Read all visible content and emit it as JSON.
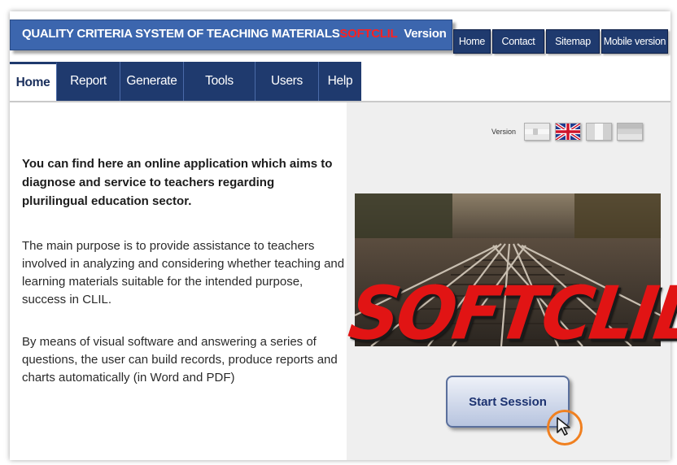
{
  "header": {
    "title_main": "QUALITY CRITERIA SYSTEM OF TEACHING MATERIALS",
    "title_brand": "SOFTCLIL",
    "title_suffix": "Version",
    "top_links": [
      "Home",
      "Contact",
      "Sitemap",
      "Mobile version"
    ]
  },
  "nav": {
    "items": [
      "Home",
      "Report",
      "Generate",
      "Tools",
      "Users",
      "Help"
    ],
    "active": "Home"
  },
  "content": {
    "intro": "You can find here an online application which aims to diagnose and service to teachers regarding plurilingual education sector.",
    "purpose": "The  main purpose is to provide assistance to teachers involved in analyzing and considering whether teaching and learning materials suitable for the intended purpose, success in CLIL.",
    "means": "By means of visual software and answering a series of questions, the user can build records, produce reports and charts automatically (in Word and PDF)"
  },
  "sidebar": {
    "version_label": "Version",
    "flags": [
      "spanish-flag-icon",
      "uk-flag-icon",
      "italian-flag-icon",
      "german-flag-icon"
    ],
    "logo_text": "SOFTCLIL",
    "start_label": "Start Session"
  },
  "colors": {
    "header_blue": "#3c66ae",
    "nav_navy": "#1f3a6e",
    "brand_red": "#e11414",
    "cursor_ring": "#f08020"
  }
}
